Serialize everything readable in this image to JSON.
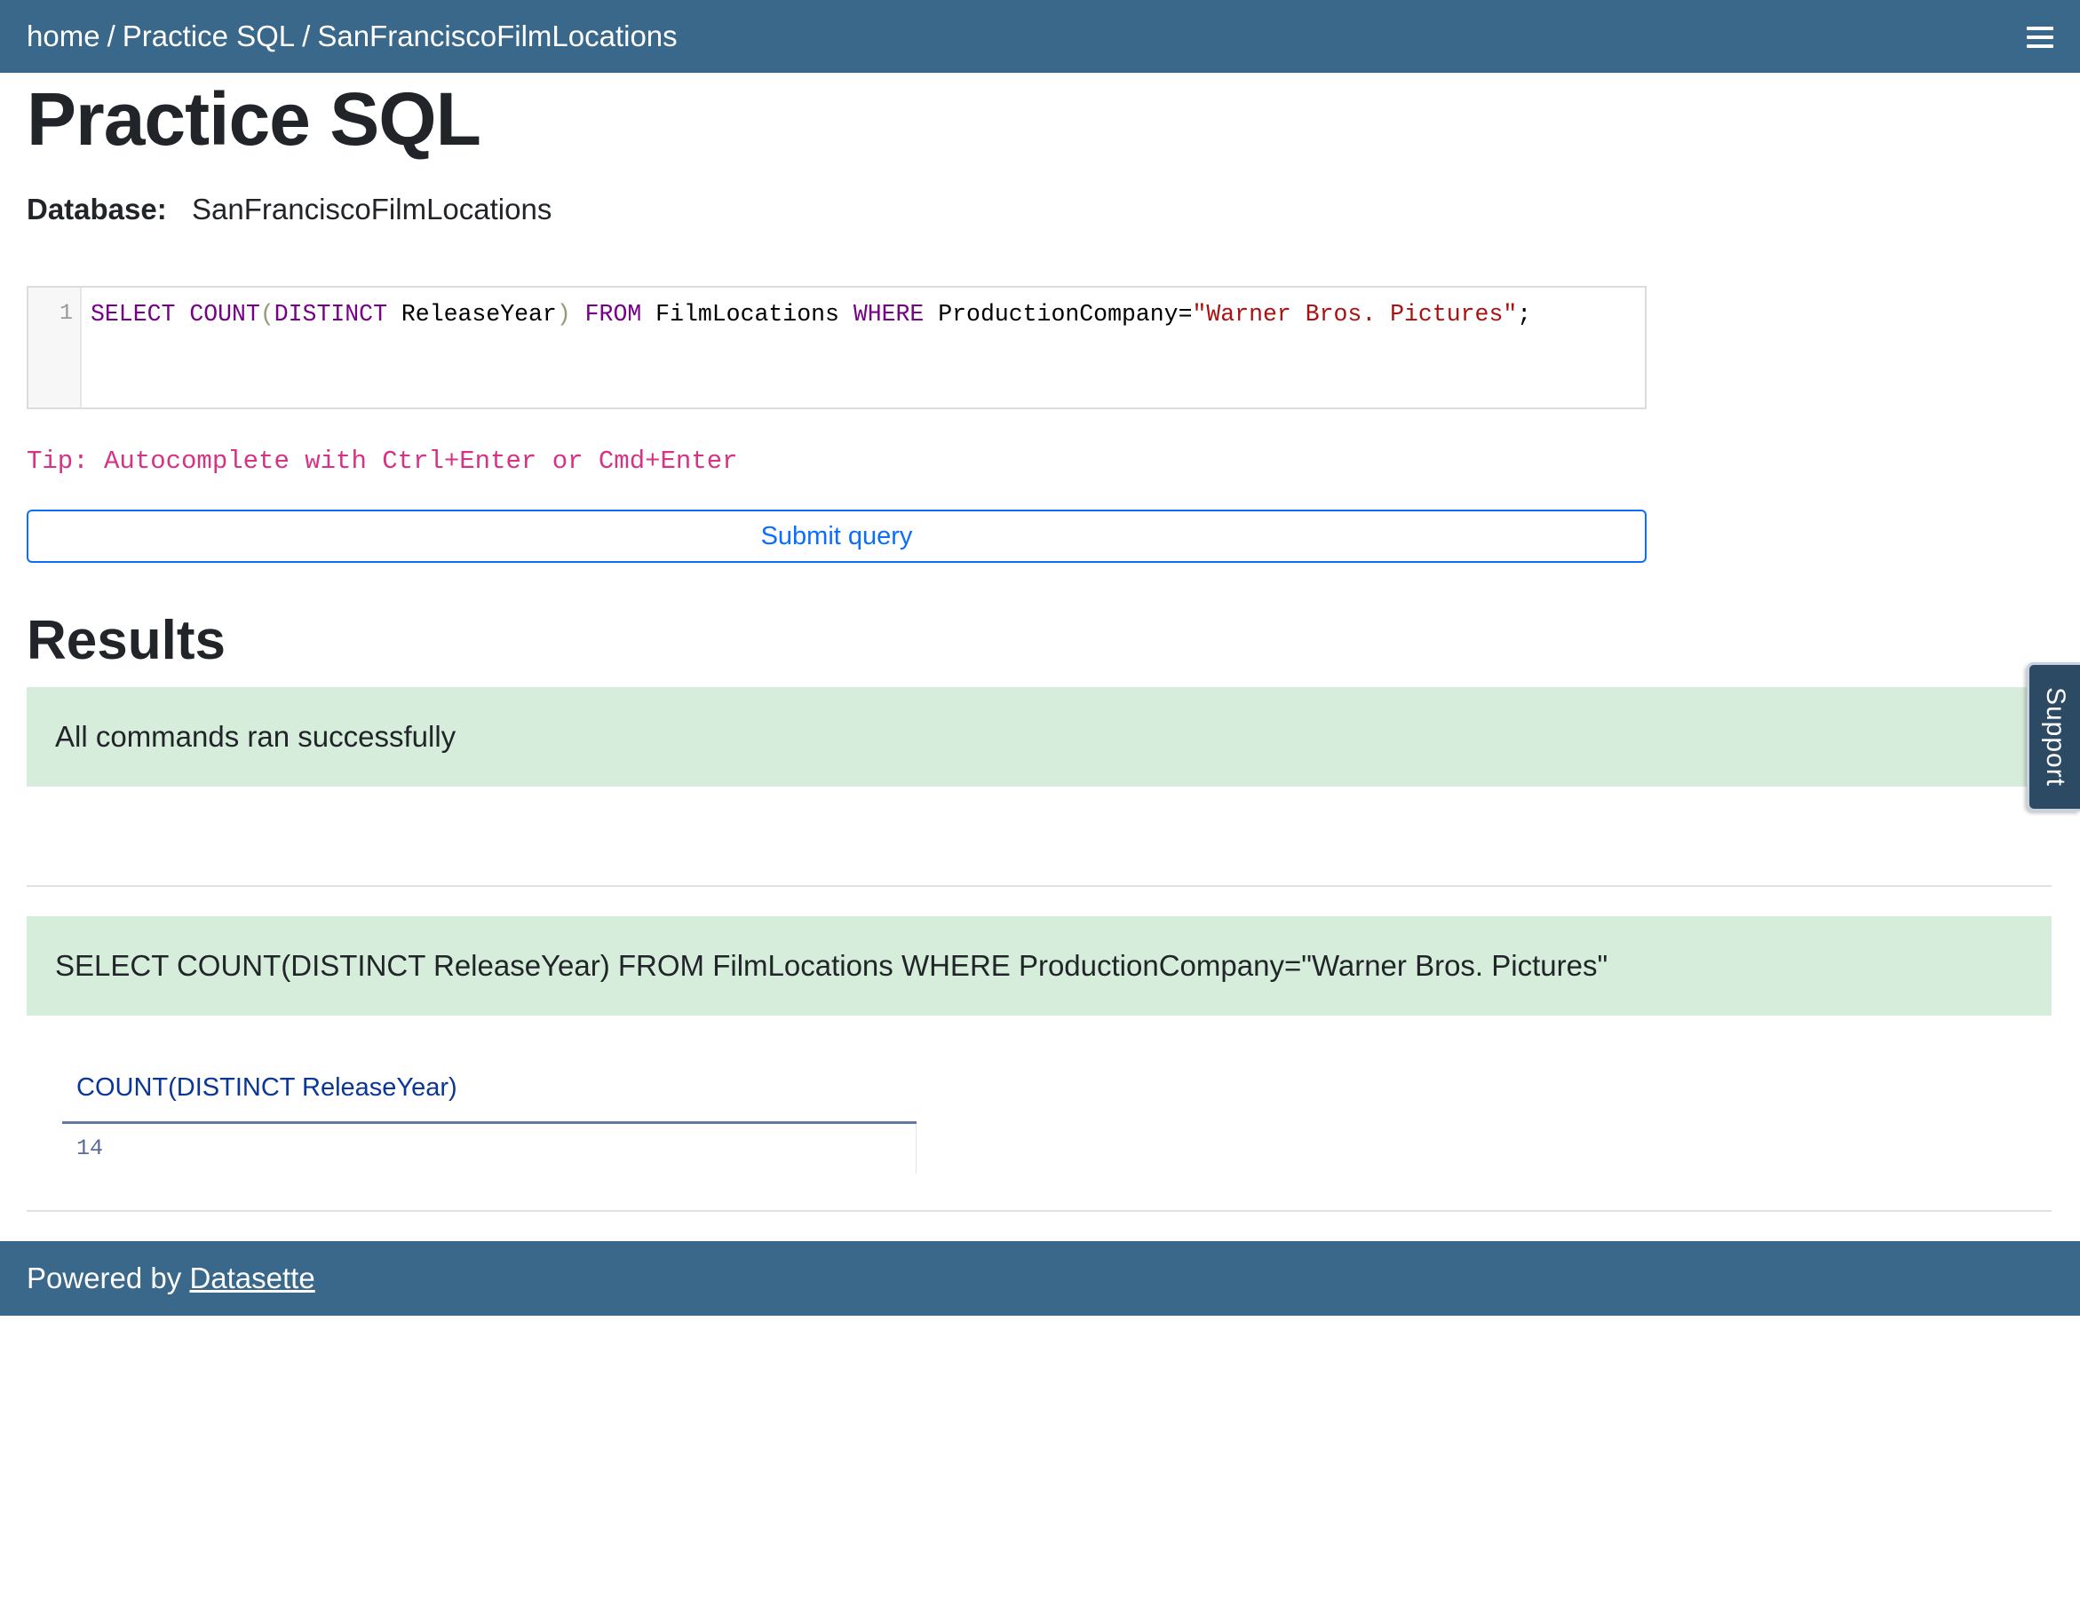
{
  "breadcrumb": {
    "items": [
      "home",
      "Practice SQL",
      "SanFranciscoFilmLocations"
    ],
    "separator": "/"
  },
  "header": {
    "menu_icon": "hamburger-menu-icon"
  },
  "page": {
    "title": "Practice SQL"
  },
  "database": {
    "label": "Database:",
    "value": "SanFranciscoFilmLocations"
  },
  "editor": {
    "line_number": "1",
    "tokens": {
      "select": "SELECT",
      "count": "COUNT",
      "lparen1": "(",
      "distinct": "DISTINCT",
      "column": " ReleaseYear",
      "rparen1": ")",
      "from": "FROM",
      "table": "FilmLocations",
      "where": "WHERE",
      "field": "ProductionCompany=",
      "string": "\"Warner Bros. Pictures\"",
      "semicolon": ";"
    }
  },
  "tip": "Tip: Autocomplete with Ctrl+Enter or Cmd+Enter",
  "submit": {
    "label": "Submit query"
  },
  "results": {
    "heading": "Results",
    "status_message": "All commands ran successfully",
    "executed_query": "SELECT COUNT(DISTINCT ReleaseYear) FROM FilmLocations WHERE ProductionCompany=\"Warner Bros. Pictures\"",
    "table": {
      "columns": [
        "COUNT(DISTINCT ReleaseYear)"
      ],
      "rows": [
        [
          "14"
        ]
      ]
    }
  },
  "footer": {
    "prefix": "Powered by ",
    "link_label": "Datasette"
  },
  "support_tab": {
    "label": "Support"
  },
  "colors": {
    "navbar": "#39688b",
    "success_bg": "#d7eddc",
    "primary": "#0d6efd",
    "tip": "#d63384"
  }
}
